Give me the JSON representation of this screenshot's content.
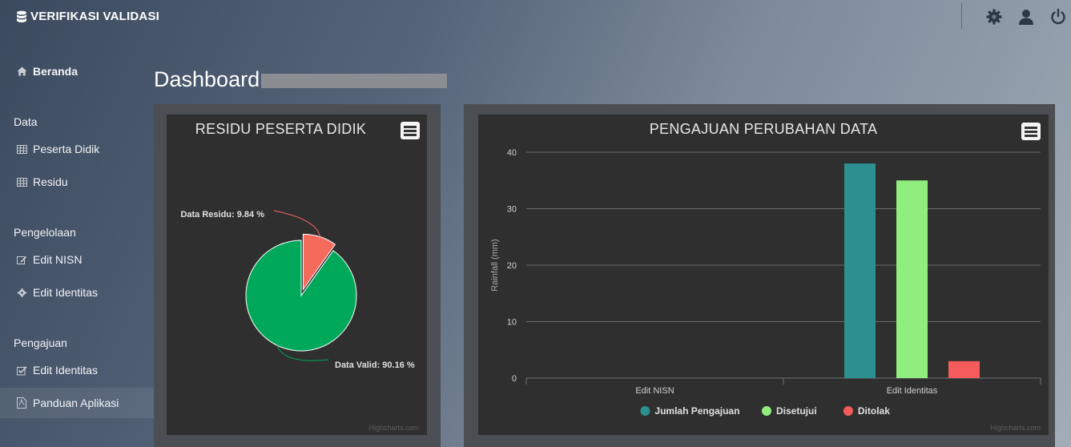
{
  "app": {
    "title": "VERIFIKASI VALIDASI"
  },
  "topbar": {
    "icons": [
      "gear-icon",
      "user-icon",
      "power-icon"
    ]
  },
  "sidebar": {
    "home": {
      "label": "Beranda",
      "icon": "home-icon"
    },
    "sections": [
      {
        "title": "Data",
        "items": [
          {
            "label": "Peserta Didik",
            "icon": "table-icon"
          },
          {
            "label": "Residu",
            "icon": "table-icon"
          }
        ]
      },
      {
        "title": "Pengelolaan",
        "items": [
          {
            "label": "Edit NISN",
            "icon": "edit-icon"
          },
          {
            "label": "Edit Identitas",
            "icon": "gear-icon"
          }
        ]
      },
      {
        "title": "Pengajuan",
        "items": [
          {
            "label": "Edit Identitas",
            "icon": "checkbox-icon"
          }
        ]
      }
    ],
    "guide": {
      "label": "Panduan Aplikasi",
      "icon": "document-icon"
    }
  },
  "main": {
    "title": "Dashboard"
  },
  "credits": "Highcharts.com",
  "chart_data": [
    {
      "type": "pie",
      "title": "RESIDU PESERTA DIDIK",
      "slices": [
        {
          "name": "Data Residu",
          "value": 9.84,
          "color": "#f46a5b",
          "label": "Data Residu: 9.84 %"
        },
        {
          "name": "Data Valid",
          "value": 90.16,
          "color": "#00a85a",
          "label": "Data Valid: 90.16 %"
        }
      ]
    },
    {
      "type": "bar",
      "title": "PENGAJUAN PERUBAHAN DATA",
      "categories": [
        "Edit NISN",
        "Edit Identitas"
      ],
      "ylabel": "Rainfall (mm)",
      "ylim": [
        0,
        40
      ],
      "yticks": [
        "0",
        "10",
        "20",
        "30",
        "40"
      ],
      "series": [
        {
          "name": "Jumlah Pengajuan",
          "color": "#2b908f",
          "values": [
            0,
            38
          ]
        },
        {
          "name": "Disetujui",
          "color": "#90ee7e",
          "values": [
            0,
            35
          ]
        },
        {
          "name": "Ditolak",
          "color": "#f45b5b",
          "values": [
            0,
            3
          ]
        }
      ],
      "legend": "bottom-center"
    }
  ]
}
